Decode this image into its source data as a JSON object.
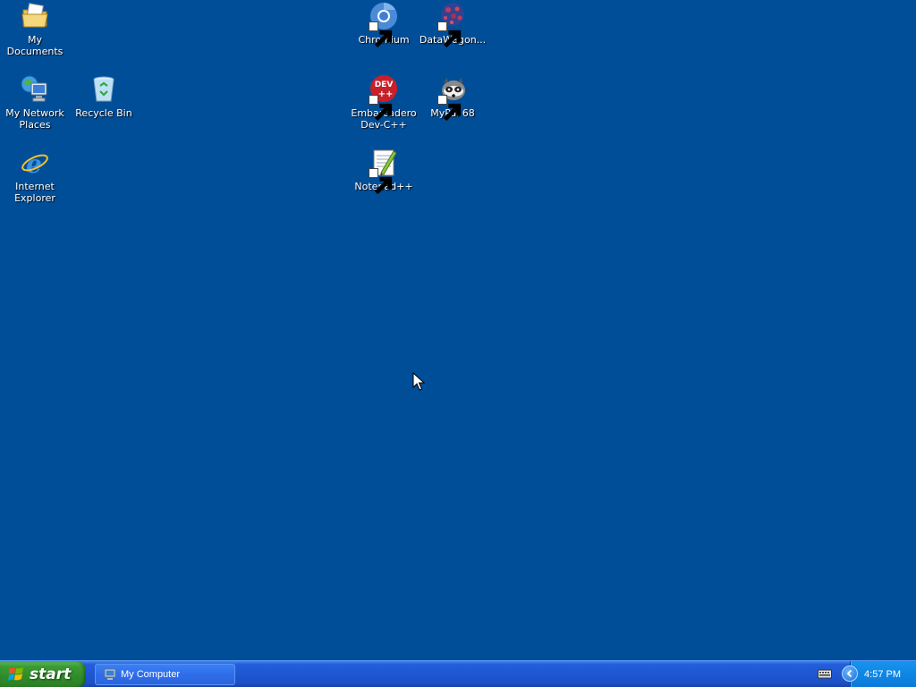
{
  "desktop": {
    "background_color": "#004e98",
    "icons": [
      {
        "label": "My Documents",
        "icon": "my-documents-icon"
      },
      {
        "label": "My Network\nPlaces",
        "icon": "network-places-icon"
      },
      {
        "label": "Recycle Bin",
        "icon": "recycle-bin-icon"
      },
      {
        "label": "Internet\nExplorer",
        "icon": "internet-explorer-icon"
      },
      {
        "label": "Chromium",
        "icon": "chromium-icon",
        "shortcut": true
      },
      {
        "label": "DataWagon...",
        "icon": "datawagon-icon",
        "shortcut": true
      },
      {
        "label": "Embarcadero\nDev-C++",
        "icon": "devcpp-icon",
        "shortcut": true
      },
      {
        "label": "MyPal 68",
        "icon": "mypal-icon",
        "shortcut": true
      },
      {
        "label": "Notepad++",
        "icon": "notepadpp-icon",
        "shortcut": true
      }
    ]
  },
  "taskbar": {
    "start_label": "start",
    "tasks": [
      {
        "label": "My Computer",
        "icon": "my-computer-icon"
      }
    ],
    "tray": {
      "clock": "4:57 PM",
      "icons": [
        "keyboard-icon",
        "show-hidden-icons-chevron"
      ]
    }
  },
  "colors": {
    "taskbar_blue": "#245edb",
    "start_green": "#3c9b34",
    "tray_blue": "#0f86e4"
  }
}
